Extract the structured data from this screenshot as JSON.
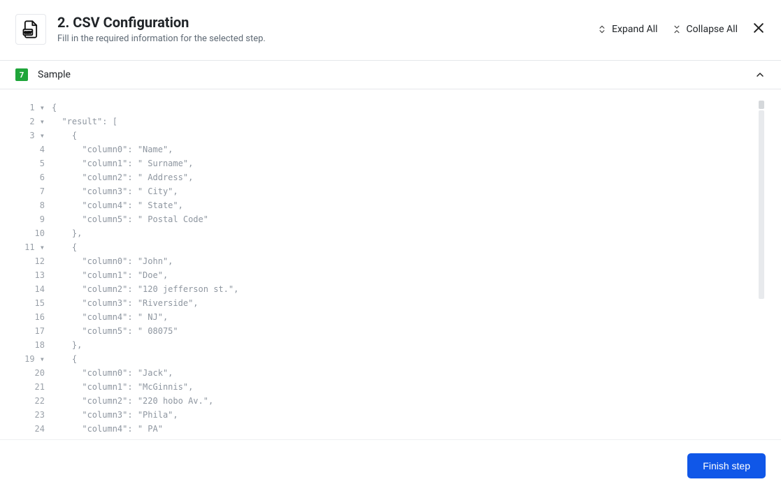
{
  "header": {
    "title": "2. CSV Configuration",
    "subtitle": "Fill in the required information for the selected step.",
    "expand_all": "Expand All",
    "collapse_all": "Collapse All"
  },
  "section": {
    "badge": "7",
    "title": "Sample"
  },
  "codeLines": [
    {
      "num": "1",
      "fold": true,
      "text": "{"
    },
    {
      "num": "2",
      "fold": true,
      "text": "  \"result\": ["
    },
    {
      "num": "3",
      "fold": true,
      "text": "    {"
    },
    {
      "num": "4",
      "fold": false,
      "text": "      \"column0\": \"Name\","
    },
    {
      "num": "5",
      "fold": false,
      "text": "      \"column1\": \" Surname\","
    },
    {
      "num": "6",
      "fold": false,
      "text": "      \"column2\": \" Address\","
    },
    {
      "num": "7",
      "fold": false,
      "text": "      \"column3\": \" City\","
    },
    {
      "num": "8",
      "fold": false,
      "text": "      \"column4\": \" State\","
    },
    {
      "num": "9",
      "fold": false,
      "text": "      \"column5\": \" Postal Code\""
    },
    {
      "num": "10",
      "fold": false,
      "text": "    },"
    },
    {
      "num": "11",
      "fold": true,
      "text": "    {"
    },
    {
      "num": "12",
      "fold": false,
      "text": "      \"column0\": \"John\","
    },
    {
      "num": "13",
      "fold": false,
      "text": "      \"column1\": \"Doe\","
    },
    {
      "num": "14",
      "fold": false,
      "text": "      \"column2\": \"120 jefferson st.\","
    },
    {
      "num": "15",
      "fold": false,
      "text": "      \"column3\": \"Riverside\","
    },
    {
      "num": "16",
      "fold": false,
      "text": "      \"column4\": \" NJ\","
    },
    {
      "num": "17",
      "fold": false,
      "text": "      \"column5\": \" 08075\""
    },
    {
      "num": "18",
      "fold": false,
      "text": "    },"
    },
    {
      "num": "19",
      "fold": true,
      "text": "    {"
    },
    {
      "num": "20",
      "fold": false,
      "text": "      \"column0\": \"Jack\","
    },
    {
      "num": "21",
      "fold": false,
      "text": "      \"column1\": \"McGinnis\","
    },
    {
      "num": "22",
      "fold": false,
      "text": "      \"column2\": \"220 hobo Av.\","
    },
    {
      "num": "23",
      "fold": false,
      "text": "      \"column3\": \"Phila\","
    },
    {
      "num": "24",
      "fold": false,
      "text": "      \"column4\": \" PA\""
    }
  ],
  "footer": {
    "finish": "Finish step"
  }
}
